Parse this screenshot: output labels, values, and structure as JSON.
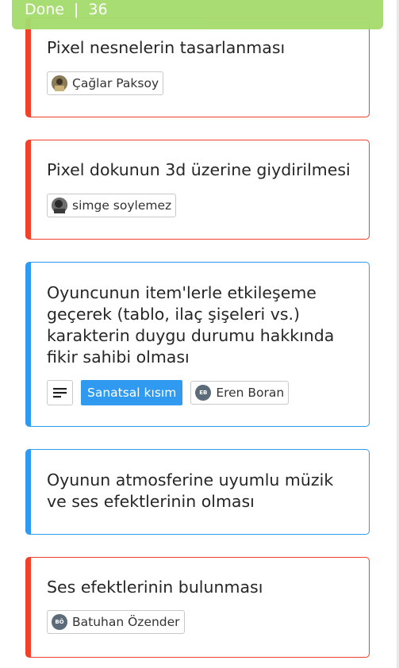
{
  "header": {
    "status": "Done",
    "separator": "|",
    "count": "36"
  },
  "colors": {
    "red": "#f0412a",
    "blue": "#2f9af0",
    "header_green": "#a5dc6e"
  },
  "cards": [
    {
      "title": "Pixel nesnelerin tasarlanması",
      "assignee": "Çağlar Paksoy",
      "avatar_type": "photo"
    },
    {
      "title": "Pixel dokunun 3d üzerine giydirilmesi",
      "assignee": "simge soylemez",
      "avatar_type": "photo"
    },
    {
      "title": "Oyuncunun item'lerle etkileşeme geçerek (tablo, ilaç şişeleri vs.) karakterin duygu durumu hakkında fikir sahibi olması",
      "label": "Sanatsal kısım",
      "assignee": "Eren Boran",
      "initials": "EB",
      "has_description": true
    },
    {
      "title": "Oyunun atmosferine uyumlu müzik ve ses efektlerinin olması"
    },
    {
      "title": "Ses efektlerinin bulunması",
      "assignee": "Batuhan Özender",
      "initials": "BÖ"
    }
  ]
}
